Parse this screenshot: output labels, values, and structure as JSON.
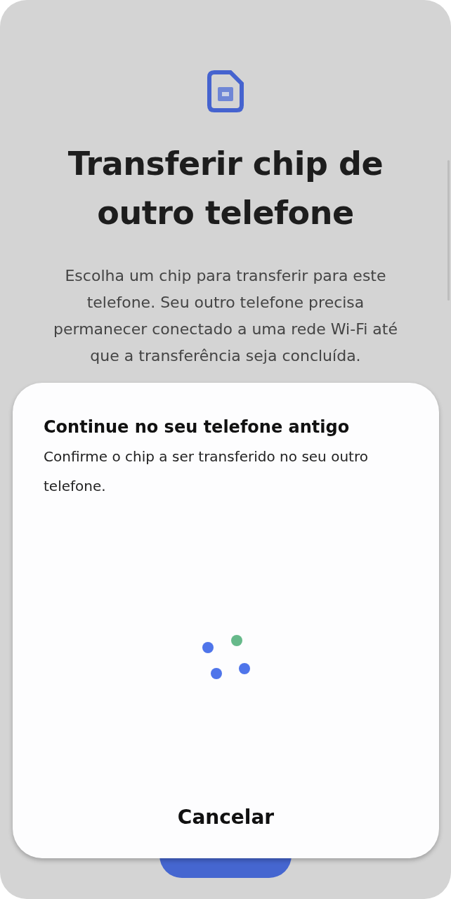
{
  "title": "Transferir chip de outro telefone",
  "description": "Escolha um chip para transferir para este telefone. Seu outro telefone precisa permanecer conectado a uma rede Wi-Fi até que a transferência seja concluída.",
  "sheet": {
    "title": "Continue no seu telefone antigo",
    "message": "Confirme o chip a ser transferido no seu outro telefone.",
    "cancel_button": {
      "label": "Cancelar"
    }
  }
}
